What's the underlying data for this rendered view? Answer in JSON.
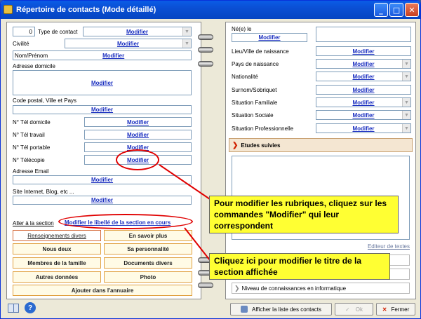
{
  "window": {
    "title": "Répertoire de contacts  (Mode détaillé)"
  },
  "common": {
    "modify": "Modifier"
  },
  "left": {
    "contact_type_value": "0",
    "contact_type_label": "Type de contact",
    "civility_label": "Civilité",
    "name_label": "Nom/Prénom",
    "home_address_label": "Adresse domicile",
    "postal_label": "Code postal, Ville et Pays",
    "tel_home_label": "N° Tél domicile",
    "tel_work_label": "N° Tél travail",
    "tel_mobile_label": "N° Tél portable",
    "fax_label": "N° Télécopie",
    "email_label": "Adresse Email",
    "website_label": "Site Internet, Blog, etc ...",
    "goto_label": "Aller à la section",
    "section_rename_link": "Modifier le libellé de la section en cours",
    "sections": [
      "Renseignements divers",
      "En savoir plus",
      "Nous deux",
      "Sa personnalité",
      "Membres de la famille",
      "Documents divers",
      "Autres données",
      "Photo"
    ],
    "add_to_directory": "Ajouter dans l'annuaire"
  },
  "right": {
    "born_label": "Né(e) le",
    "birthplace_label": "Lieu/Ville de naissance",
    "birth_country_label": "Pays de naissance",
    "nationality_label": "Nationalité",
    "nickname_label": "Surnom/Sobriquet",
    "family_status_label": "Situation Familiale",
    "social_status_label": "Situation Sociale",
    "professional_status_label": "Situation Professionnelle",
    "studies_label": "Etudes suivies",
    "text_editor_link": "Editeur de textes",
    "it_level_label": "Niveau de connaissances en informatique"
  },
  "callouts": {
    "rubriques": "Pour modifier les rubriques, cliquez sur les commandes \"Modifier\" qui leur correspondent",
    "section_title": "Cliquez ici pour modifier le titre de la section affichée"
  },
  "footer": {
    "show_list": "Afficher la liste des contacts",
    "ok": "Ok",
    "close": "Fermer"
  },
  "colors": {
    "title_bar": "#0a4fd4",
    "link": "#1a2fc0",
    "callout": "#ffff33",
    "annotation": "#e00000",
    "section_border": "#e0a040"
  }
}
